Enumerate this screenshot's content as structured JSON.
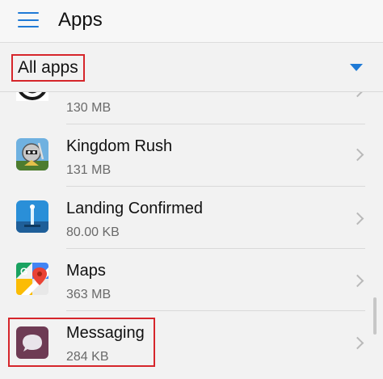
{
  "header": {
    "title": "Apps",
    "menu_icon": "hamburger-menu-icon"
  },
  "filter": {
    "selected": "All apps",
    "accent": "#1f7ad6"
  },
  "apps": [
    {
      "name": "",
      "size": "130 MB",
      "icon": "partial-app-icon"
    },
    {
      "name": "Kingdom Rush",
      "size": "131 MB",
      "icon": "kingdom-rush-icon"
    },
    {
      "name": "Landing Confirmed",
      "size": "80.00 KB",
      "icon": "landing-confirmed-icon"
    },
    {
      "name": "Maps",
      "size": "363 MB",
      "icon": "maps-icon"
    },
    {
      "name": "Messaging",
      "size": "284 KB",
      "icon": "messaging-icon"
    }
  ],
  "colors": {
    "highlight": "#d6262b",
    "chevron": "#b9b9b9"
  }
}
